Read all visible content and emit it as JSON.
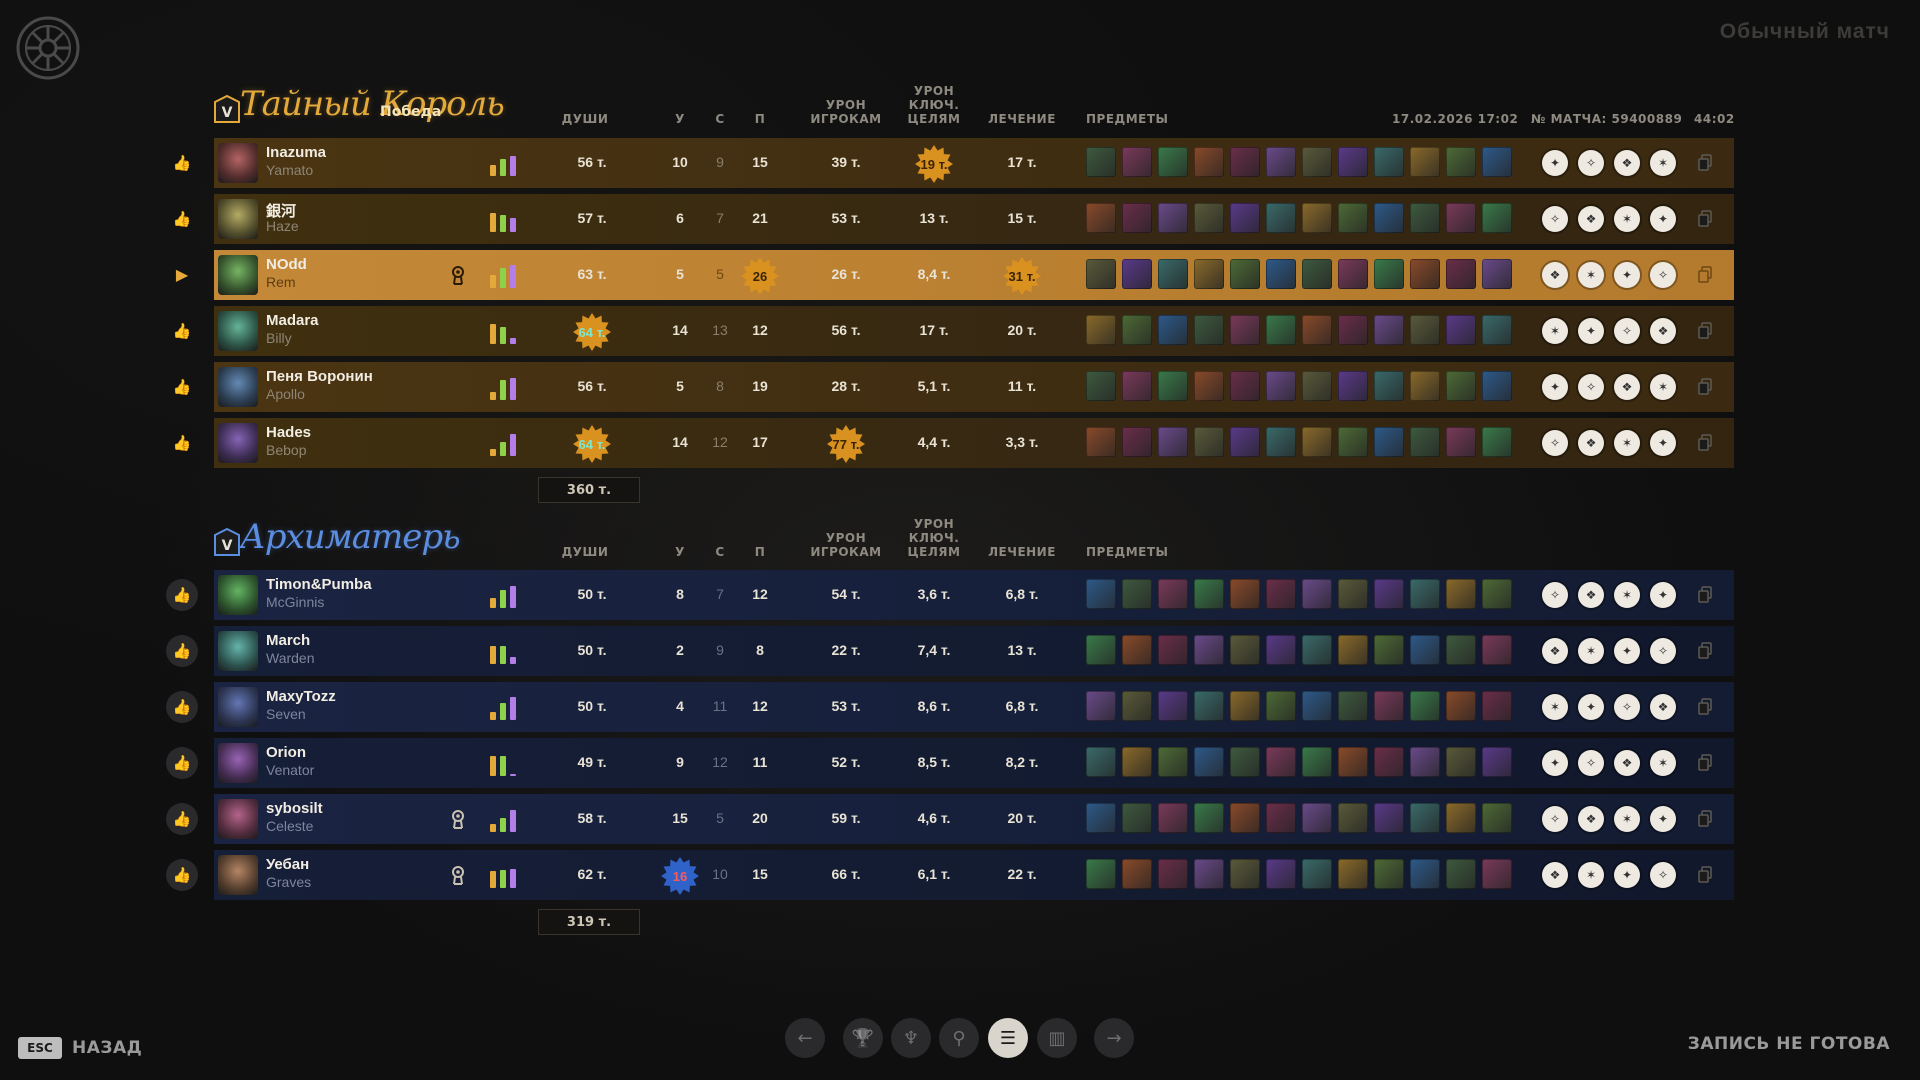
{
  "header": {
    "mode_title": "Обычный матч",
    "date": "17.02.2026 17:02",
    "match_id": "№ МАТЧА: 59400889",
    "duration": "44:02"
  },
  "columns": {
    "souls": "ДУШИ",
    "kills": "У",
    "deaths": "С",
    "assists": "П",
    "player_damage": [
      "УРОН",
      "ИГРОКАМ"
    ],
    "objective_damage": [
      "УРОН",
      "КЛЮЧ.",
      "ЦЕЛЯМ"
    ],
    "healing": "ЛЕЧЕНИЕ",
    "items": "ПРЕДМЕТЫ"
  },
  "teams": [
    {
      "name": "Тайный Король",
      "result": "Победа",
      "color": "#e3a93a",
      "total_souls": "360 т.",
      "players": [
        {
          "name": "Inazuma",
          "hero": "Yamato",
          "souls": "56 т.",
          "k": "10",
          "d": "9",
          "a": "15",
          "pdmg": "39 т.",
          "odmg": "19 т.",
          "heal": "17 т.",
          "highlight": [
            "odmg"
          ],
          "bars": [
            0.45,
            0.7,
            0.85
          ],
          "role_icon": false
        },
        {
          "name": "銀河",
          "hero": "Haze",
          "souls": "57 т.",
          "k": "6",
          "d": "7",
          "a": "21",
          "pdmg": "53 т.",
          "odmg": "13 т.",
          "heal": "15 т.",
          "highlight": [],
          "bars": [
            0.8,
            0.7,
            0.6
          ],
          "role_icon": false
        },
        {
          "name": "NOdd",
          "hero": "Rem",
          "souls": "63 т.",
          "k": "5",
          "d": "5",
          "a": "26",
          "pdmg": "26 т.",
          "odmg": "8,4 т.",
          "heal": "31 т.",
          "highlight": [
            "a",
            "heal"
          ],
          "bars": [
            0.55,
            0.85,
            0.95
          ],
          "role_icon": true,
          "is_me": true
        },
        {
          "name": "Madara",
          "hero": "Billy",
          "souls": "64 т.",
          "k": "14",
          "d": "13",
          "a": "12",
          "pdmg": "56 т.",
          "odmg": "17 т.",
          "heal": "20 т.",
          "highlight": [
            "souls"
          ],
          "bars": [
            0.85,
            0.7,
            0.25
          ],
          "role_icon": false
        },
        {
          "name": "Пеня Воронин",
          "hero": "Apollo",
          "souls": "56 т.",
          "k": "5",
          "d": "8",
          "a": "19",
          "pdmg": "28 т.",
          "odmg": "5,1 т.",
          "heal": "11 т.",
          "highlight": [],
          "bars": [
            0.35,
            0.85,
            0.9
          ],
          "role_icon": false
        },
        {
          "name": "Hades",
          "hero": "Bebop",
          "souls": "64 т.",
          "k": "14",
          "d": "12",
          "a": "17",
          "pdmg": "77 т.",
          "odmg": "4,4 т.",
          "heal": "3,3 т.",
          "highlight": [
            "souls",
            "pdmg"
          ],
          "bars": [
            0.3,
            0.6,
            0.9
          ],
          "role_icon": false
        }
      ]
    },
    {
      "name": "Архиматерь",
      "result": "",
      "color": "#5b8de0",
      "total_souls": "319 т.",
      "players": [
        {
          "name": "Timon&Pumba",
          "hero": "McGinnis",
          "souls": "50 т.",
          "k": "8",
          "d": "7",
          "a": "12",
          "pdmg": "54 т.",
          "odmg": "3,6 т.",
          "heal": "6,8 т.",
          "highlight": [],
          "bars": [
            0.4,
            0.75,
            0.9
          ],
          "role_icon": false
        },
        {
          "name": "March",
          "hero": "Warden",
          "souls": "50 т.",
          "k": "2",
          "d": "9",
          "a": "8",
          "pdmg": "22 т.",
          "odmg": "7,4 т.",
          "heal": "13 т.",
          "highlight": [],
          "bars": [
            0.75,
            0.75,
            0.3
          ],
          "role_icon": false
        },
        {
          "name": "MaxyTozz",
          "hero": "Seven",
          "souls": "50 т.",
          "k": "4",
          "d": "11",
          "a": "12",
          "pdmg": "53 т.",
          "odmg": "8,6 т.",
          "heal": "6,8 т.",
          "highlight": [],
          "bars": [
            0.35,
            0.7,
            0.95
          ],
          "role_icon": false
        },
        {
          "name": "Orion",
          "hero": "Venator",
          "souls": "49 т.",
          "k": "9",
          "d": "12",
          "a": "11",
          "pdmg": "52 т.",
          "odmg": "8,5 т.",
          "heal": "8,2 т.",
          "highlight": [],
          "bars": [
            0.85,
            0.85,
            0.0
          ],
          "role_icon": false
        },
        {
          "name": "sybosilt",
          "hero": "Celeste",
          "souls": "58 т.",
          "k": "15",
          "d": "5",
          "a": "20",
          "pdmg": "59 т.",
          "odmg": "4,6 т.",
          "heal": "20 т.",
          "highlight": [],
          "bars": [
            0.35,
            0.6,
            0.9
          ],
          "role_icon": true,
          "liked": true
        },
        {
          "name": "Уебан",
          "hero": "Graves",
          "souls": "62 т.",
          "k": "16",
          "d": "10",
          "a": "15",
          "pdmg": "66 т.",
          "odmg": "6,1 т.",
          "heal": "22 т.",
          "highlight": [
            "k"
          ],
          "bars": [
            0.7,
            0.75,
            0.8
          ],
          "role_icon": true
        }
      ]
    }
  ],
  "footer": {
    "esc_key": "ESC",
    "back_label": "НАЗАД",
    "replay_status": "ЗАПИСЬ НЕ ГОТОВА",
    "nav_icons": [
      "arrow-left-icon",
      "trophy-icon",
      "claw-icon",
      "key-icon",
      "list-icon",
      "chart-icon",
      "arrow-right-icon"
    ],
    "active_nav": "list-icon"
  },
  "colors": {
    "team1_row": "#4b3512",
    "team1_self": "#c48938",
    "team2_row": "#1a2442",
    "burst_orange": "#d9911f",
    "burst_blue": "#2f63c9"
  }
}
